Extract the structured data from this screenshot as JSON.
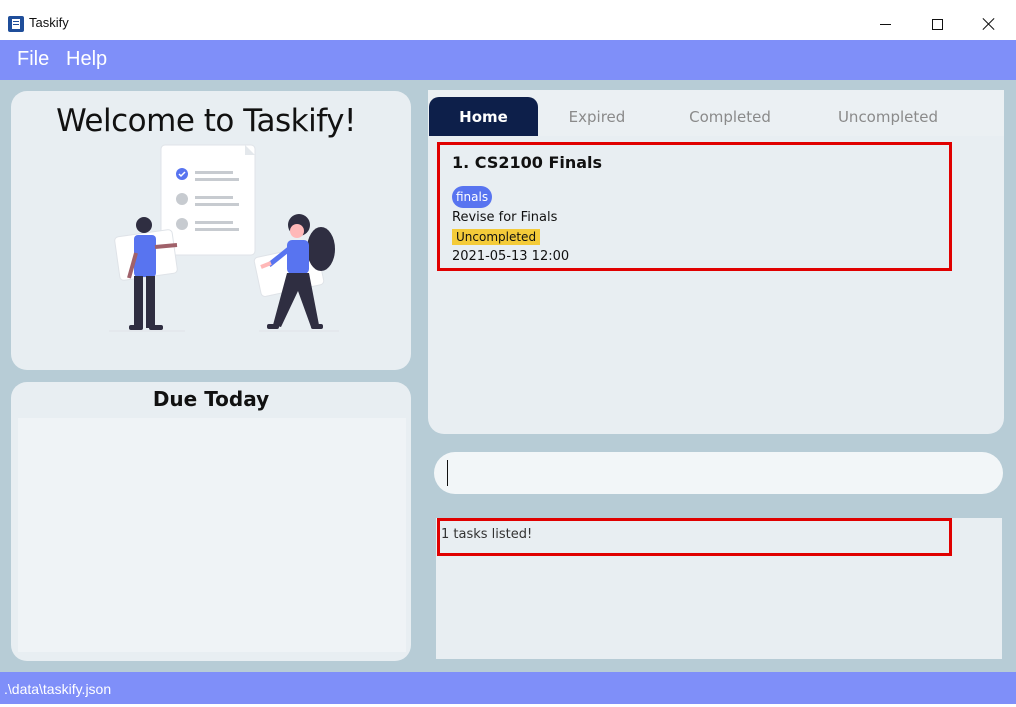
{
  "window": {
    "title": "Taskify",
    "controls": {
      "minimize": "minimize-icon",
      "maximize": "maximize-icon",
      "close": "close-icon"
    }
  },
  "menu": {
    "items": [
      "File",
      "Help"
    ]
  },
  "welcome": {
    "title": "Welcome to Taskify!",
    "illustration": "two-people-checklist-illustration"
  },
  "due_today": {
    "title": "Due Today",
    "items": []
  },
  "tabs": [
    {
      "label": "Home",
      "active": true
    },
    {
      "label": "Expired",
      "active": false
    },
    {
      "label": "Completed",
      "active": false
    },
    {
      "label": "Uncompleted",
      "active": false
    }
  ],
  "tasks": [
    {
      "title": "1. CS2100 Finals",
      "tag": "finals",
      "description": "Revise for Finals",
      "status": "Uncompleted",
      "deadline": "2021-05-13 12:00"
    }
  ],
  "command_box": {
    "value": ""
  },
  "result": {
    "text": "1 tasks listed!"
  },
  "status_bar": {
    "path": ".\\data\\taskify.json"
  },
  "colors": {
    "accent": "#7f8ff9",
    "background": "#b7ccd6",
    "panel": "#e8eef2",
    "active_tab": "#0d1f4a",
    "tag": "#5874f0",
    "status_badge": "#f4cb39",
    "highlight": "#e00000"
  }
}
